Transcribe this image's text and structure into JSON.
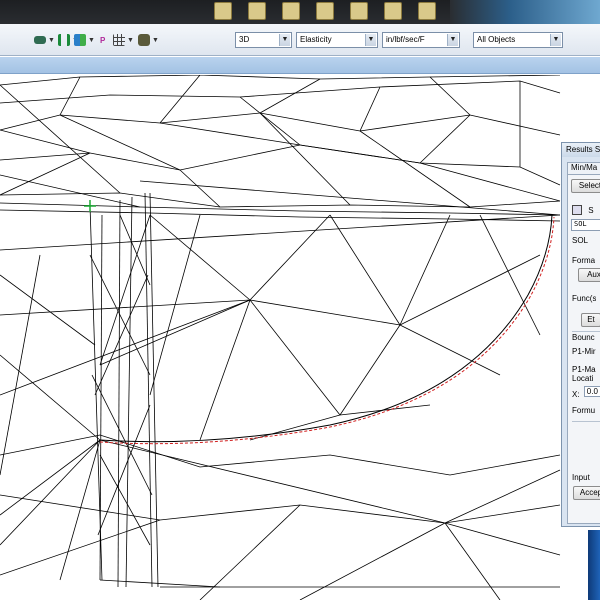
{
  "toolbar": {
    "view_mode": "3D",
    "result_type": "Elasticity",
    "units": "in/lbf/sec/F",
    "object_filter": "All Objects",
    "icons": [
      "layer-icon",
      "weld-icon",
      "chart-icon",
      "p-icon",
      "grid-icon",
      "camera-icon"
    ],
    "p_label": "P"
  },
  "results_panel": {
    "title": "Results S",
    "tab": "Min/Ma",
    "select_label": "Select",
    "sol_tag": "SOL",
    "sol_label": "SOL",
    "format_label": "Forma",
    "aux_button": "Aux",
    "func_label": "Func(s",
    "et_button": "Et",
    "bounds_label": "Bounc",
    "p1_min_label": "P1-Mir",
    "p1_max_label": "P1-Ma",
    "location_label": "Locati",
    "x_label": "X:",
    "x_value": "0.0",
    "formula_label": "Formu",
    "input_label": "Input",
    "accept_button": "Accep",
    "panel_icon_glyph": "S"
  },
  "colors": {
    "mesh": "#000000",
    "edge_highlight": "#d11f1f",
    "origin_marker": "#1aa832",
    "toolbar_bg": "#e6ecf3",
    "band": "#aac8e8"
  }
}
